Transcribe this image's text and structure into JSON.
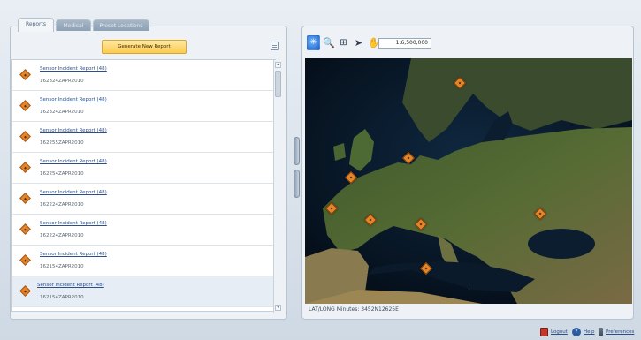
{
  "tabs": [
    {
      "label": "Reports",
      "active": true
    },
    {
      "label": "Medical",
      "active": false
    },
    {
      "label": "Preset Locations",
      "active": false
    }
  ],
  "toolbar": {
    "generate_label": "Generate New Report",
    "export_icon": "export-icon"
  },
  "reports": [
    {
      "title": "Sensor Incident Report (48)",
      "dtg": "162324ZAPR2010"
    },
    {
      "title": "Sensor Incident Report (48)",
      "dtg": "162324ZAPR2010"
    },
    {
      "title": "Sensor Incident Report (48)",
      "dtg": "162255ZAPR2010"
    },
    {
      "title": "Sensor Incident Report (48)",
      "dtg": "162254ZAPR2010"
    },
    {
      "title": "Sensor Incident Report (48)",
      "dtg": "162224ZAPR2010"
    },
    {
      "title": "Sensor Incident Report (48)",
      "dtg": "162224ZAPR2010"
    },
    {
      "title": "Sensor Incident Report (48)",
      "dtg": "162154ZAPR2010"
    },
    {
      "title": "Sensor Incident Report (48)",
      "dtg": "162154ZAPR2010"
    }
  ],
  "map": {
    "scale": "1:6,500,000",
    "tools": [
      "globe-icon",
      "zoom-icon",
      "layers-icon",
      "pointer-icon",
      "pan-hand-icon"
    ],
    "coords_text": "LAT/LONG Minutes: 3452N12625E"
  },
  "footer": {
    "logout": "Logout",
    "help": "Help",
    "preferences": "Preferences"
  },
  "colors": {
    "accent": "#fbcb4e",
    "marker": "#e2852b",
    "link": "#2c4f8a"
  }
}
